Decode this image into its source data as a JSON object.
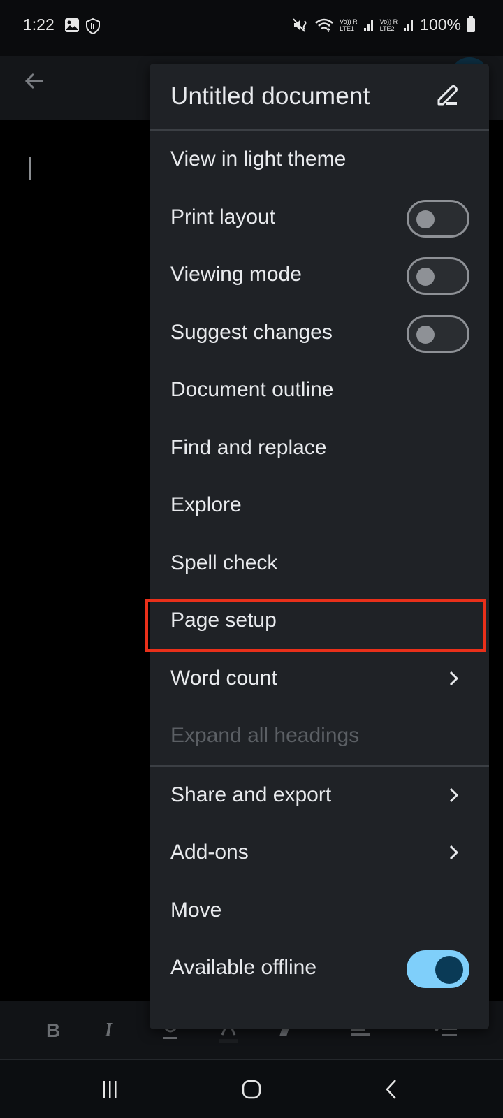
{
  "status_bar": {
    "time": "1:22",
    "left_icons": [
      "gallery-icon",
      "shield-touch-icon"
    ],
    "right_icons": [
      "mute-vibrate-icon",
      "wifi-icon",
      "signal-lte1-icon",
      "signal-lte2-icon",
      "battery-icon"
    ],
    "sim1_label_top": "Vo)) R",
    "sim1_label_bottom": "LTE1",
    "sim2_label_top": "Vo)) R",
    "sim2_label_bottom": "LTE2",
    "battery": "100%"
  },
  "app_bar": {
    "back_icon": "arrow-left-icon"
  },
  "menu": {
    "title": "Untitled document",
    "edit_icon": "pencil-icon",
    "items": [
      {
        "label": "View in light theme",
        "type": "action"
      },
      {
        "label": "Print layout",
        "type": "toggle",
        "on": false
      },
      {
        "label": "Viewing mode",
        "type": "toggle",
        "on": false
      },
      {
        "label": "Suggest changes",
        "type": "toggle",
        "on": false
      },
      {
        "label": "Document outline",
        "type": "action"
      },
      {
        "label": "Find and replace",
        "type": "action"
      },
      {
        "label": "Explore",
        "type": "action"
      },
      {
        "label": "Spell check",
        "type": "action"
      },
      {
        "label": "Page setup",
        "type": "action",
        "highlighted": true
      },
      {
        "label": "Word count",
        "type": "submenu"
      },
      {
        "label": "Expand all headings",
        "type": "action",
        "disabled": true
      },
      {
        "label": "Share and export",
        "type": "submenu"
      },
      {
        "label": "Add-ons",
        "type": "submenu"
      },
      {
        "label": "Move",
        "type": "action"
      },
      {
        "label": "Available offline",
        "type": "toggle",
        "on": true
      }
    ]
  },
  "format_bar": {
    "bold": "B",
    "italic": "I",
    "tools": [
      "bold-icon",
      "italic-icon",
      "underline-icon",
      "text-color-icon",
      "highlight-icon",
      "align-icon",
      "list-icon"
    ]
  },
  "nav_bar": {
    "buttons": [
      "recent-apps-icon",
      "home-icon",
      "back-icon"
    ]
  },
  "colors": {
    "menu_bg": "#1f2226",
    "toggle_on": "#7fcffa",
    "highlight": "#e9301a"
  }
}
